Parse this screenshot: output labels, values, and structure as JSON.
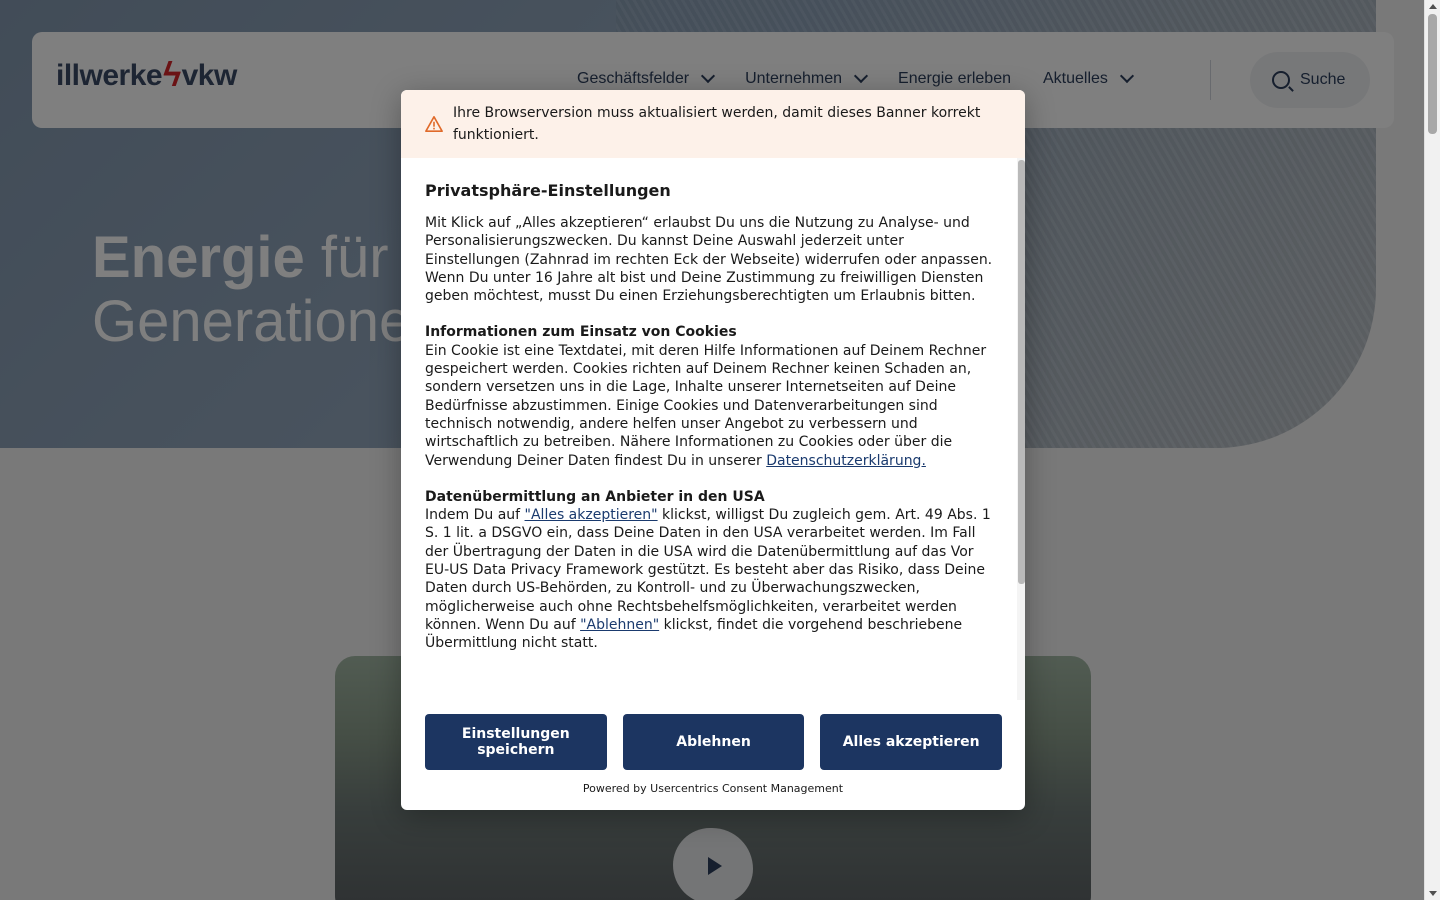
{
  "site": {
    "logo_left": "illwerke",
    "logo_bolt": "ϟ",
    "logo_right": "vkw",
    "nav": [
      {
        "label": "Geschäftsfelder",
        "has_dropdown": true
      },
      {
        "label": "Unternehmen",
        "has_dropdown": true
      },
      {
        "label": "Energie erleben",
        "has_dropdown": false
      },
      {
        "label": "Aktuelles",
        "has_dropdown": true
      }
    ],
    "search_label": "Suche",
    "hero_title_bold": "Energie",
    "hero_title_light": " für",
    "hero_title_line2": "Generationen"
  },
  "consent": {
    "warning": "Ihre Browserversion muss aktualisiert werden, damit dieses Banner korrekt funktioniert.",
    "title": "Privatsphäre-Einstellungen",
    "intro": "Mit Klick auf „Alles akzeptieren“ erlaubst Du uns die Nutzung zu Analyse- und Personalisierungszwecken. Du kannst Deine Auswahl jederzeit unter Einstellungen (Zahnrad im rechten Eck der Webseite) widerrufen oder anpassen. Wenn Du unter 16 Jahre alt bist und Deine Zustimmung zu freiwilligen Diensten geben möchtest, musst Du einen Erziehungsberechtigten um Erlaubnis bitten.",
    "cookies_head": "Informationen zum Einsatz von Cookies",
    "cookies_text": "Ein Cookie ist eine Textdatei, mit deren Hilfe Informationen auf Deinem Rechner gespeichert werden. Cookies richten auf Deinem Rechner keinen Schaden an, sondern versetzen uns in die Lage, Inhalte unserer Internetseiten auf Deine Bedürfnisse abzustimmen. Einige Cookies und Datenverarbeitungen sind technisch notwendig, andere helfen unser Angebot zu verbessern und wirtschaftlich zu betreiben. Nähere Informationen zu Cookies oder über die Verwendung Deiner Daten findest Du in unserer ",
    "privacy_link": "Datenschutzerklärung.",
    "usa_head": "Datenübermittlung an Anbieter in den USA",
    "usa_text_1": "Indem Du auf ",
    "usa_link_accept": "\"Alles akzeptieren\"",
    "usa_text_2": " klickst, willigst Du zugleich gem. Art. 49 Abs. 1 S. 1 lit. a DSGVO ein, dass Deine Daten in den USA verarbeitet werden. Im Fall der Übertragung der Daten in die USA wird die Datenübermittlung auf das Vor EU-US Data Privacy Framework gestützt. Es besteht aber das Risiko, dass Deine Daten durch US-Behörden, zu Kontroll- und zu Überwachungszwecken, möglicherweise auch ohne Rechtsbehelfsmöglichkeiten, verarbeitet werden können. Wenn Du auf ",
    "usa_link_decline": "\"Ablehnen\"",
    "usa_text_3": " klickst, findet die vorgehend beschriebene Übermittlung nicht statt.",
    "btn_save": "Einstellungen speichern",
    "btn_decline": "Ablehnen",
    "btn_accept": "Alles akzeptieren",
    "powered_by": "Powered by Usercentrics Consent Management"
  },
  "colors": {
    "accent": "#1c3561",
    "warning_bg": "#fdf1e9",
    "warning_icon": "#e06a2a",
    "logo_bolt": "#d6262a"
  }
}
